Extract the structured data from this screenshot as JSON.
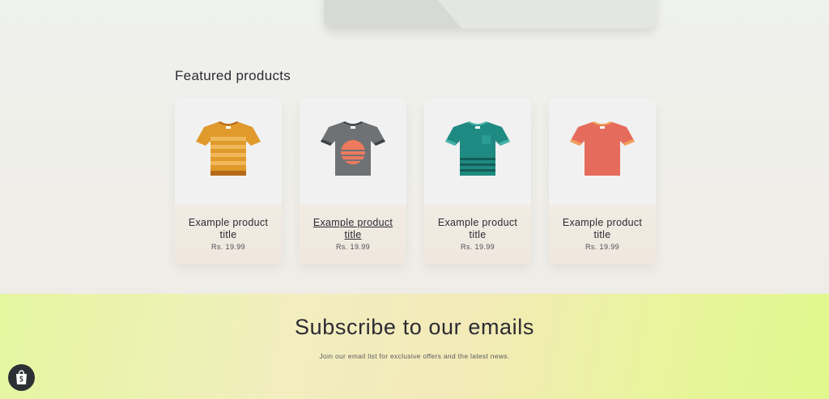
{
  "featured": {
    "heading": "Featured products",
    "products": [
      {
        "title": "Example product title",
        "price": "Rs. 19.99",
        "icon": "striped-orange-tshirt-icon",
        "color": "#e09a2b"
      },
      {
        "title": "Example product title",
        "price": "Rs. 19.99",
        "icon": "gray-sunset-tshirt-icon",
        "color": "#6f7275"
      },
      {
        "title": "Example product title",
        "price": "Rs. 19.99",
        "icon": "teal-pocket-tshirt-icon",
        "color": "#1f8a82"
      },
      {
        "title": "Example product title",
        "price": "Rs. 19.99",
        "icon": "coral-tshirt-icon",
        "color": "#e56b5c"
      }
    ]
  },
  "newsletter": {
    "title": "Subscribe to our emails",
    "text": "Join our email list for exclusive offers and the latest news."
  },
  "badge": {
    "icon": "shopify-bag-icon"
  }
}
